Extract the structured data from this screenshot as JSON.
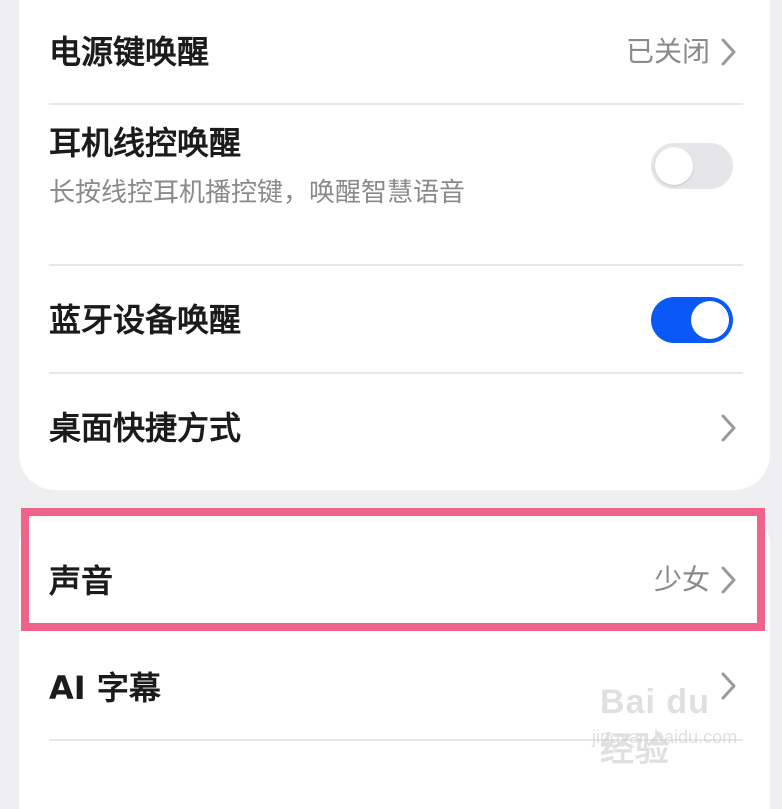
{
  "settings_group_1": {
    "power_key_wake": {
      "label": "电源键唤醒",
      "value": "已关闭"
    },
    "headset_wire_wake": {
      "label": "耳机线控唤醒",
      "description": "长按线控耳机播控键，唤醒智慧语音",
      "enabled": false
    },
    "bluetooth_device_wake": {
      "label": "蓝牙设备唤醒",
      "enabled": true
    },
    "desktop_shortcut": {
      "label": "桌面快捷方式"
    }
  },
  "settings_group_2": {
    "voice": {
      "label": "声音",
      "value": "少女"
    },
    "ai_subtitles": {
      "label": "AI 字幕"
    }
  },
  "colors": {
    "toggle_on": "#0a59f7",
    "highlight": "#f0648c"
  },
  "watermark": {
    "logo": "Bai du 经验",
    "url": "jingyan.baidu.com"
  }
}
